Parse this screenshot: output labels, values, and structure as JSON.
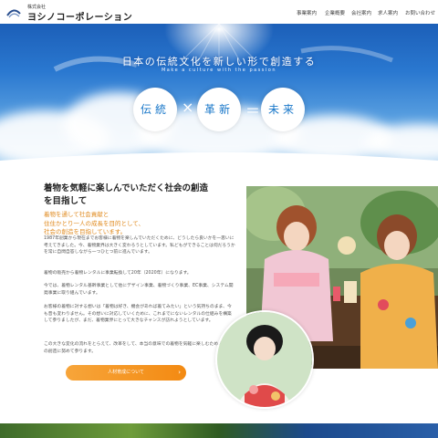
{
  "header": {
    "logo_small": "株式会社",
    "logo_name": "ヨシノコーポレーション",
    "nav": [
      "事業案内",
      "企業概要",
      "会社案内",
      "求人案内",
      "お問い合わせ"
    ]
  },
  "hero": {
    "title": "日本の伝統文化を新しい形で創造する",
    "subtitle": "Make a culture with the passion",
    "circles": [
      "伝統",
      "革新",
      "未来"
    ],
    "operators": [
      "×",
      "＝"
    ]
  },
  "content": {
    "title_lines": [
      "着物を気軽に楽しんでいただく社会の創造",
      "を目指して"
    ],
    "lead_lines": [
      "着物を通して社会貢献と",
      "住住かとり一人の成長を目的として、",
      "社会の創造を目指しています。"
    ],
    "paragraphs": [
      "1987年創業から現在までお客様に着物を楽しんでいただくために、どうしたら良いかを一思いに考えてきました。今、着物業界は大きく変わろうとしています。私どもができることは何だろうかを常に自問自答しながら一つひとつ前に進んでいます。",
      "着物の販売から着物レンタルに事業転換して20年（2020年）になります。",
      "今では、着物レンタル基幹事業として他にデザイン事業、着物づくり事業、EC事業、システム開発事業に取り組んでいます。",
      "お客様の着物に対する想いは「着物は好き、機会があれば着てみたい」という気持ちのまま、今も昔も変わりません。その想いに対応していくために、これまでにないレンタルの仕組みを構築して参りましたが、まだ、着物業界にとって大きなチャンスが訪れようとしています。",
      "この大きな変化の流れをとらえて、改革をして、本当の意味での着物を気軽に楽しむための社会の創造に努めて参ります。"
    ],
    "button_label": "人材育成について"
  },
  "colors": {
    "accent_orange": "#f38a12",
    "lead_orange": "#e08a1e",
    "circle_text": "#1877c9",
    "sky_blue": "#2a78d0"
  }
}
